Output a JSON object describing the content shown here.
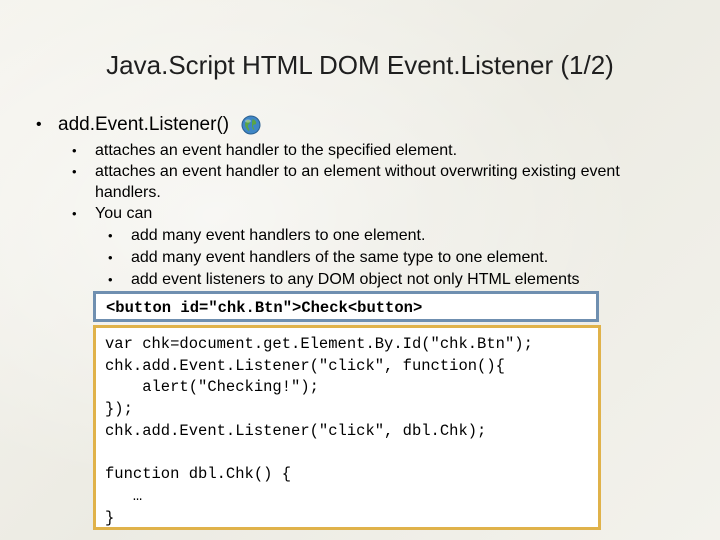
{
  "title": "Java.Script HTML DOM Event.Listener (1/2)",
  "bullet_symbol": "•",
  "main_point": "add.Event.Listener()",
  "sub_points": [
    "attaches an event handler to the specified element.",
    "attaches an event handler to an element without overwriting existing event",
    "handlers.",
    "You can"
  ],
  "sub_sub_points": [
    "add many event handlers to one element.",
    "add many event handlers of the same type to one element.",
    "add event listeners to any DOM object not only HTML elements"
  ],
  "button_code": "<button id=\"chk.Btn\">Check<button>",
  "code_lines": [
    "var chk=document.get.Element.By.Id(\"chk.Btn\");",
    "chk.add.Event.Listener(\"click\", function(){",
    "    alert(\"Checking!\");",
    "});",
    "chk.add.Event.Listener(\"click\", dbl.Chk);",
    "",
    "function dbl.Chk() {",
    "   …",
    "}"
  ],
  "colors": {
    "button_border": "#6f8fb0",
    "code_border": "#e0b24a"
  },
  "icons": {
    "globe": "globe-icon"
  }
}
